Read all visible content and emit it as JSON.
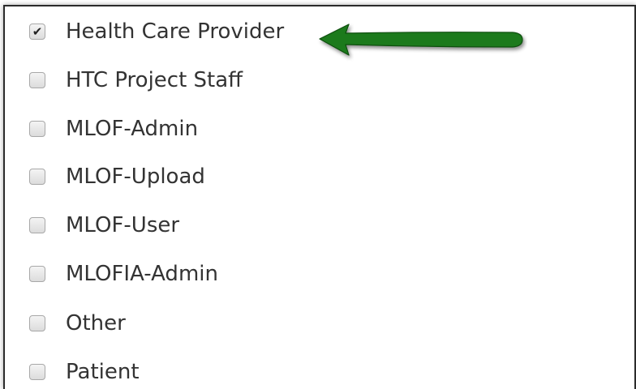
{
  "roles": [
    {
      "label": "Health Care Provider",
      "checked": true
    },
    {
      "label": "HTC Project Staff",
      "checked": false
    },
    {
      "label": "MLOF-Admin",
      "checked": false
    },
    {
      "label": "MLOF-Upload",
      "checked": false
    },
    {
      "label": "MLOF-User",
      "checked": false
    },
    {
      "label": "MLOFIA-Admin",
      "checked": false
    },
    {
      "label": "Other",
      "checked": false
    },
    {
      "label": "Patient",
      "checked": false
    }
  ],
  "annotation": {
    "arrow_color": "#1e7a1e",
    "arrow_target": "Health Care Provider"
  },
  "check_glyph": "✔"
}
